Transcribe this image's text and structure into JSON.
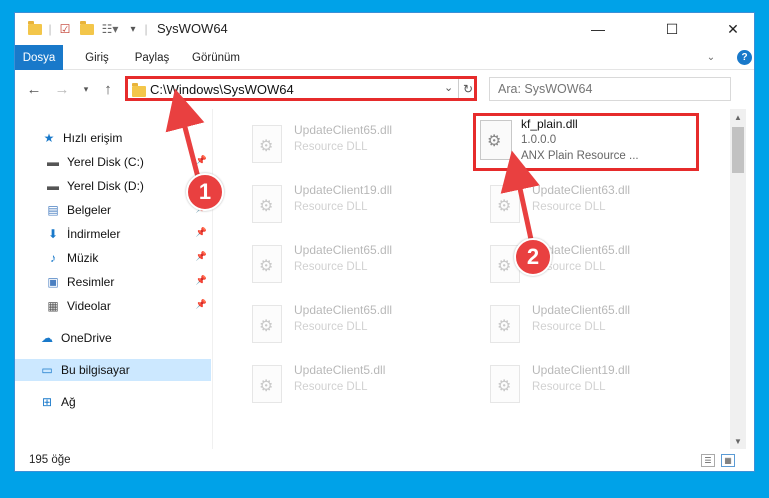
{
  "window": {
    "title": "SysWOW64",
    "minimize_glyph": "—",
    "maximize_glyph": "☐",
    "close_glyph": "✕"
  },
  "ribbon": {
    "tabs": [
      "Dosya",
      "Giriş",
      "Paylaş",
      "Görünüm"
    ],
    "help": "?"
  },
  "address": {
    "path": "C:\\Windows\\SysWOW64",
    "search_placeholder": "Ara: SysWOW64"
  },
  "nav": {
    "items": [
      {
        "label": "Hızlı erişim",
        "icon": "star-icon",
        "glyph": "★",
        "color": "#1979ca",
        "pinned": false
      },
      {
        "label": "Yerel Disk (C:)",
        "icon": "drive-icon",
        "glyph": "▬",
        "color": "#555",
        "pinned": true
      },
      {
        "label": "Yerel Disk (D:)",
        "icon": "drive-icon",
        "glyph": "▬",
        "color": "#555",
        "pinned": false
      },
      {
        "label": "Belgeler",
        "icon": "documents-icon",
        "glyph": "▤",
        "color": "#4a7fc1",
        "pinned": true
      },
      {
        "label": "İndirmeler",
        "icon": "download-icon",
        "glyph": "⬇",
        "color": "#1979ca",
        "pinned": true
      },
      {
        "label": "Müzik",
        "icon": "music-icon",
        "glyph": "♪",
        "color": "#1979ca",
        "pinned": true
      },
      {
        "label": "Resimler",
        "icon": "pictures-icon",
        "glyph": "▣",
        "color": "#4a7fc1",
        "pinned": true
      },
      {
        "label": "Videolar",
        "icon": "video-icon",
        "glyph": "▦",
        "color": "#555",
        "pinned": true
      },
      {
        "label": "OneDrive",
        "icon": "cloud-icon",
        "glyph": "☁",
        "color": "#1979ca",
        "pinned": false
      },
      {
        "label": "Bu bilgisayar",
        "icon": "computer-icon",
        "glyph": "▭",
        "color": "#1979ca",
        "pinned": false
      },
      {
        "label": "Ağ",
        "icon": "network-icon",
        "glyph": "⊞",
        "color": "#1979ca",
        "pinned": false
      }
    ]
  },
  "files": {
    "left_column": [
      {
        "name": "UpdateClient65.dll",
        "desc": "Resource DLL"
      },
      {
        "name": "UpdateClient19.dll",
        "desc": "Resource DLL"
      },
      {
        "name": "UpdateClient65.dll",
        "desc": "Resource DLL"
      },
      {
        "name": "UpdateClient65.dll",
        "desc": "Resource DLL"
      },
      {
        "name": "UpdateClient5.dll",
        "desc": "Resource DLL"
      }
    ],
    "right_column": [
      {
        "name": "UpdateClient63.dll",
        "desc": "Resource DLL"
      },
      {
        "name": "UpdateClient65.dll",
        "desc": "Resource DLL"
      },
      {
        "name": "UpdateClient65.dll",
        "desc": "Resource DLL"
      },
      {
        "name": "UpdateClient19.dll",
        "desc": "Resource DLL"
      }
    ],
    "highlighted": {
      "name": "kf_plain.dll",
      "version": "1.0.0.0",
      "desc": "ANX Plain Resource ..."
    }
  },
  "status": {
    "count": "195 öğe"
  },
  "callouts": [
    "1",
    "2"
  ],
  "colors": {
    "accent": "#1979ca",
    "highlight": "#e62b2b",
    "callout": "#e94040"
  }
}
